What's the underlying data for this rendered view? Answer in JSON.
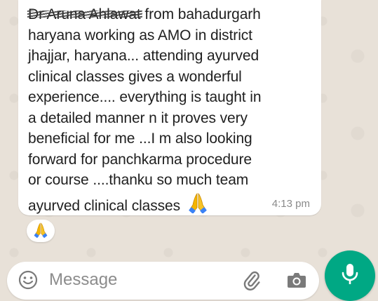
{
  "message": {
    "redacted_name": "Dr Aruna Ahlawat",
    "lines": [
      " from bahadurgarh",
      "haryana working as AMO in district",
      "jhajjar, haryana... attending ayurved",
      "clinical classes gives a wonderful",
      "experience.... everything is taught in",
      "a detailed manner n it proves very",
      "beneficial for me ...I m also looking",
      "forward for panchkarma procedure",
      "or course ....thanku so much team",
      "ayurved clinical classes"
    ],
    "emoji": "folded-hands",
    "time": "4:13 pm"
  },
  "reaction": {
    "emoji": "folded-hands"
  },
  "composer": {
    "placeholder": "Message",
    "icons": [
      "smiley-icon",
      "paperclip-icon",
      "camera-icon",
      "microphone-icon"
    ]
  },
  "colors": {
    "wallpaper": "#e8e1d8",
    "bubble": "#ffffff",
    "accent": "#00a884",
    "timestamp": "#8a8a8a"
  }
}
